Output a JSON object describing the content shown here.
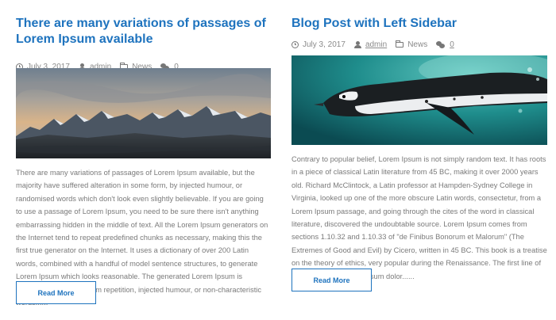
{
  "posts": [
    {
      "title": "There are many variations of passages of Lorem Ipsum available",
      "date": "July 3, 2017",
      "author": "admin",
      "category": "News",
      "comments": "0",
      "image": "mountain-landscape",
      "excerpt": "There are many variations of passages of Lorem Ipsum available, but the majority have suffered alteration in some form, by injected humour, or randomised words which don't look even slightly believable. If you are going to use a passage of Lorem Ipsum, you need to be sure there isn't anything embarrassing hidden in the middle of text. All the Lorem Ipsum generators on the Internet tend to repeat predefined chunks as necessary, making this the first true generator on the Internet. It uses a dictionary of over 200 Latin words, combined with a handful of model sentence structures, to generate Lorem Ipsum which looks reasonable. The generated Lorem Ipsum is therefore always free from repetition, injected humour, or non-characteristic words......",
      "read_more": "Read More"
    },
    {
      "title": "Blog Post with Left Sidebar",
      "date": "July 3, 2017",
      "author": "admin",
      "category": "News",
      "comments": "0",
      "image": "penguin-underwater",
      "excerpt": "Contrary to popular belief, Lorem Ipsum is not simply random text. It has roots in a piece of classical Latin literature from 45 BC, making it over 2000 years old. Richard McClintock, a Latin professor at Hampden-Sydney College in Virginia, looked up one of the more obscure Latin words, consectetur, from a Lorem Ipsum passage, and going through the cites of the word in classical literature, discovered the undoubtable source. Lorem Ipsum comes from sections 1.10.32 and 1.10.33 of \"de Finibus Bonorum et Malorum\" (The Extremes of Good and Evil) by Cicero, written in 45 BC. This book is a treatise on the theory of ethics, very popular during the Renaissance. The first line of Lorem Ipsum, \"Lorem ipsum dolor......",
      "read_more": "Read More"
    }
  ],
  "colors": {
    "accent": "#1e73be",
    "meta": "#8a8a8a",
    "text": "#7a7a7a"
  }
}
